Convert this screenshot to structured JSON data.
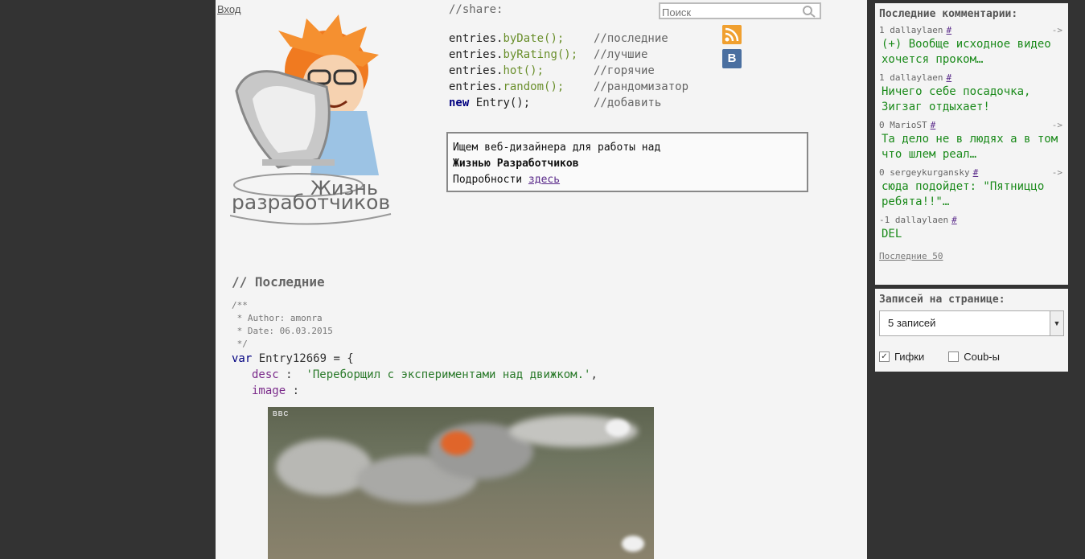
{
  "header": {
    "login_label": "Вход"
  },
  "share": {
    "title": "//share:",
    "links": [
      {
        "object": "entries.",
        "method": "byDate();",
        "comment": "//последние"
      },
      {
        "object": "entries.",
        "method": "byRating();",
        "comment": "//лучшие"
      },
      {
        "object": "entries.",
        "method": "hot();",
        "comment": "//горячие"
      },
      {
        "object": "entries.",
        "method": "random();",
        "comment": "//рандомизатор"
      }
    ],
    "new_entry": {
      "keyword": "new",
      "rest": " Entry();",
      "comment": "//добавить"
    }
  },
  "logo": {
    "line1": "Жизнь",
    "line2": "разработчиков"
  },
  "search": {
    "placeholder": "Поиск"
  },
  "social": {
    "vk_label": "B"
  },
  "ad": {
    "line1": "Ищем веб-дизайнера для работы над",
    "line2": "Жизнью Разработчиков",
    "line3_prefix": "Подробности ",
    "link": "здесь"
  },
  "feed": {
    "section_title": "// Последние",
    "entry": {
      "comment_open": "/**",
      "author_line": " * Author: amonra",
      "date_line": " * Date: 06.03.2015",
      "comment_close": " */",
      "keyword": "var",
      "name": " Entry12669 = {",
      "desc_key": "desc",
      "desc_sep": " :  ",
      "desc_value": "'Переборщил с экспериментами над движком.'",
      "desc_end": ",",
      "image_key": "image",
      "image_sep": " :",
      "image_watermark": "BBC"
    }
  },
  "sidebar": {
    "comments_title": "Последние комментарии:",
    "comments": [
      {
        "score": "1",
        "user": "dallaylaen",
        "hash": "#",
        "arrow": "->",
        "text": "(+) Вообще исходное видео хочется проком…"
      },
      {
        "score": "1",
        "user": "dallaylaen",
        "hash": "#",
        "arrow": "",
        "text": "Ничего себе посадочка, Зигзаг отдыхает!"
      },
      {
        "score": "0",
        "user": "MarioST",
        "hash": "#",
        "arrow": "->",
        "text": "Та дело не в людях а в том что шлем реал…"
      },
      {
        "score": "0",
        "user": "sergeykurgansky",
        "hash": "#",
        "arrow": "->",
        "text": "сюда подойдет: \"Пятниццо ребята!!\"…"
      },
      {
        "score": "-1",
        "user": "dallaylaen",
        "hash": "#",
        "arrow": "",
        "text": "DEL"
      }
    ],
    "last50": "Последние 50",
    "per_page_title": "Записей на странице:",
    "per_page_value": "5 записей",
    "filters": [
      {
        "label": "Гифки",
        "checked": true
      },
      {
        "label": "Coub-ы",
        "checked": false
      }
    ]
  },
  "colors": {
    "background": "#333333",
    "page": "#f4f4f4",
    "comment_text": "#1a8a1a",
    "link": "#5a2a8a"
  }
}
